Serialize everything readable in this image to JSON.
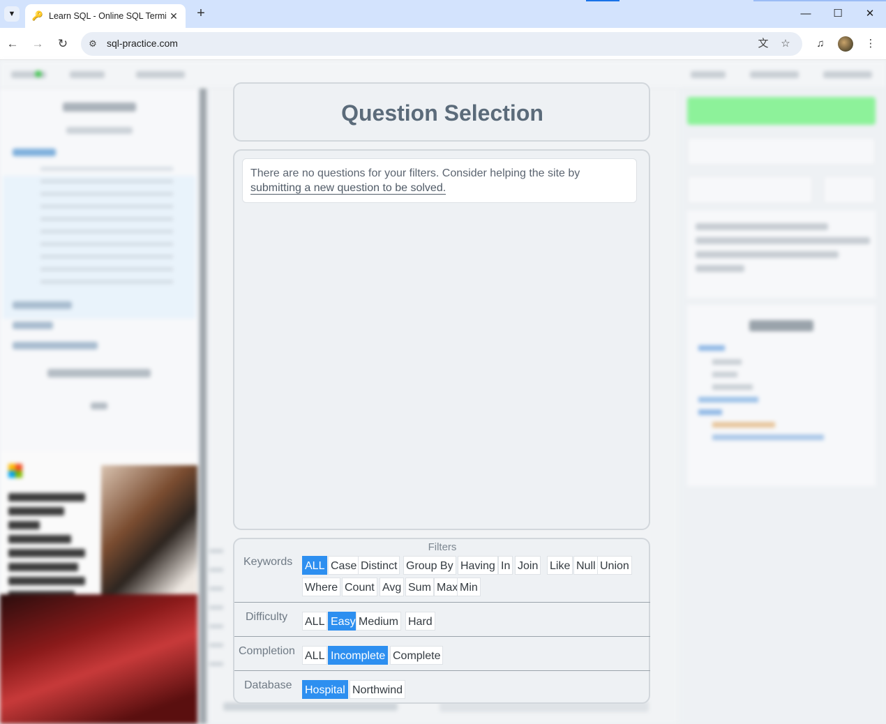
{
  "browser": {
    "tab_title": "Learn SQL - Online SQL Termi",
    "url": "sql-practice.com",
    "icons": {
      "tab_dropdown": "chevron-down-icon",
      "favicon": "key-icon",
      "close": "close-icon",
      "new_tab": "plus-icon",
      "back": "arrow-left-icon",
      "forward": "arrow-right-icon",
      "reload": "reload-icon",
      "site_info": "tune-icon",
      "translate": "translate-icon",
      "bookmark": "star-icon",
      "media": "media-controls-icon",
      "menu": "kebab-menu-icon"
    }
  },
  "question_selection": {
    "title": "Question Selection",
    "message_prefix": "There are no questions for your filters. Consider helping the site by ",
    "message_link": "submitting a new question to be solved."
  },
  "filters": {
    "title": "Filters",
    "keywords": {
      "label": "Keywords",
      "options": [
        "ALL",
        "Case",
        "Distinct",
        "Group By",
        "Having",
        "In",
        "Join",
        "Like",
        "Null",
        "Union",
        "Where",
        "Count",
        "Avg",
        "Sum",
        "Max",
        "Min"
      ],
      "selected": "ALL"
    },
    "difficulty": {
      "label": "Difficulty",
      "options": [
        "ALL",
        "Easy",
        "Medium",
        "Hard"
      ],
      "selected": "Easy"
    },
    "completion": {
      "label": "Completion",
      "options": [
        "ALL",
        "Incomplete",
        "Complete"
      ],
      "selected": "Incomplete"
    },
    "database": {
      "label": "Database",
      "options": [
        "Hospital",
        "Northwind"
      ],
      "selected": "Hospital"
    }
  },
  "colors": {
    "accent": "#2d8ff0",
    "panel_border": "#d2d7dc",
    "title_text": "#5b6b7a",
    "success_green": "#8df29a"
  }
}
